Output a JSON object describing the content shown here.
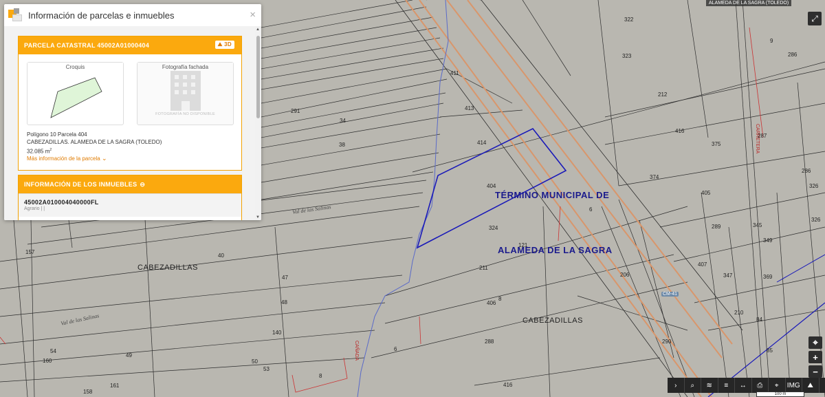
{
  "map": {
    "reference_label": "ALAMEDA DE LA SAGRA (TOLEDO)",
    "municipality_line1": "TÉRMINO MUNICIPAL DE",
    "municipality_line2": "ALAMEDA DE LA SAGRA",
    "places": [
      "CABEZADILLAS",
      "CABEZADILLAS"
    ],
    "stream_labels": [
      "Val de las Salinas",
      "Val de las Salinas"
    ],
    "road_labels": [
      "CARRETERA",
      "CAÑADA"
    ],
    "road_shield": "CM-41",
    "scale_text": "100 m",
    "parcel_numbers": [
      "322",
      "323",
      "212",
      "416",
      "375",
      "374",
      "405",
      "289",
      "345",
      "349",
      "407",
      "347",
      "369",
      "210",
      "84",
      "85",
      "206",
      "286",
      "287",
      "286",
      "326",
      "326",
      "411",
      "413",
      "414",
      "404",
      "324",
      "211",
      "406",
      "288",
      "290",
      "416",
      "291",
      "34",
      "38",
      "40",
      "47",
      "48",
      "140",
      "49",
      "50",
      "53",
      "54",
      "160",
      "161",
      "158",
      "157",
      "121",
      "8",
      "6",
      "6",
      "8",
      "9"
    ]
  },
  "controls": {
    "fullscreen_icon": "expand-icon",
    "zoom_in": "+",
    "zoom_out": "−",
    "locate_icon": "target-icon",
    "toolbar": [
      {
        "name": "expand-toolbar-button",
        "icon": "chevron-right-icon",
        "glyph": "›"
      },
      {
        "name": "search-button",
        "icon": "search-icon",
        "glyph": "⌕"
      },
      {
        "name": "layers-button",
        "icon": "layers-icon",
        "glyph": "≋"
      },
      {
        "name": "layers-alt-button",
        "icon": "stack-icon",
        "glyph": "≡"
      },
      {
        "name": "measure-button",
        "icon": "ruler-icon",
        "glyph": "↔"
      },
      {
        "name": "print-button",
        "icon": "print-icon",
        "glyph": "⎙"
      },
      {
        "name": "coordinates-button",
        "icon": "pin-icon",
        "glyph": "⌖"
      },
      {
        "name": "img-button",
        "icon": "img-text-icon",
        "glyph": "IMG"
      },
      {
        "name": "3d-button",
        "icon": "3d-icon",
        "glyph": "⛰"
      },
      {
        "name": "globe-button",
        "icon": "globe-icon",
        "glyph": "●"
      }
    ]
  },
  "panel": {
    "title": "Información de parcelas e inmuebles",
    "close": "×",
    "parcel": {
      "header": "PARCELA CATASTRAL 45002A01000404",
      "btn_3d": "3D",
      "croquis_caption": "Croquis",
      "photo_caption": "Fotografía fachada",
      "photo_unavailable": "FOTOGRAFÍA NO DISPONIBLE",
      "line1": "Polígono 10 Parcela 404",
      "line2": "CABEZADILLAS. ALAMEDA DE LA SAGRA (TOLEDO)",
      "area_value": "32.085 m",
      "area_sup": "2",
      "more_link": "Más información de la parcela"
    },
    "buildings": {
      "header": "INFORMACIÓN DE LOS INMUEBLES",
      "ref": "45002A010004040000FL",
      "use": "Agrario  |  |"
    }
  },
  "colors": {
    "orange": "#fba90e",
    "map_bg": "#b9b7b0",
    "parcel_highlight": "#1a1ab8",
    "road": "#d9966b",
    "stream": "#5a6ac8"
  }
}
